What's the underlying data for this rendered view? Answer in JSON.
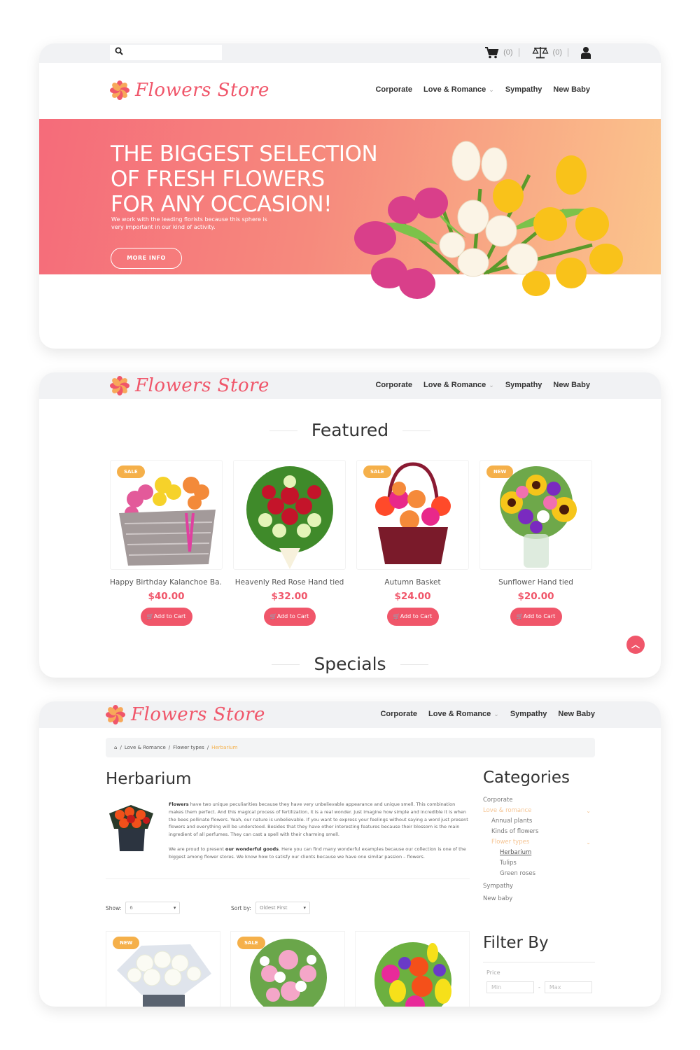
{
  "colors": {
    "accent": "#f0566a",
    "badge": "#f5b04a",
    "active_category": "#f5c493"
  },
  "topbar": {
    "search_placeholder": "",
    "cart_count": "(0)",
    "compare_count": "(0)"
  },
  "brand": {
    "name": "Flowers Store"
  },
  "nav": {
    "items": [
      {
        "label": "Corporate"
      },
      {
        "label": "Love & Romance",
        "has_dropdown": true
      },
      {
        "label": "Sympathy"
      },
      {
        "label": "New Baby"
      }
    ]
  },
  "hero": {
    "headline_1": "THE BIGGEST SELECTION",
    "headline_2": "OF FRESH FLOWERS",
    "headline_3": "FOR ANY OCCASION!",
    "text": "We work with the leading florists because this sphere is very important in our kind of activity.",
    "button": "MORE INFO"
  },
  "featured": {
    "title": "Featured",
    "products": [
      {
        "badge": "SALE",
        "name": "Happy Birthday Kalanchoe Ba...",
        "price": "$40.00",
        "cta": "Add to Cart"
      },
      {
        "badge": "",
        "name": "Heavenly Red Rose Hand tied",
        "price": "$32.00",
        "cta": "Add to Cart"
      },
      {
        "badge": "SALE",
        "name": "Autumn Basket",
        "price": "$24.00",
        "cta": "Add to Cart"
      },
      {
        "badge": "NEW",
        "name": "Sunflower Hand tied",
        "price": "$20.00",
        "cta": "Add to Cart"
      }
    ]
  },
  "specials": {
    "title": "Specials"
  },
  "category_page": {
    "breadcrumb": [
      "Love & Romance",
      "Flower types",
      "Herbarium"
    ],
    "title": "Herbarium",
    "desc_p1_bold": "Flowers",
    "desc_p1": " have two unique peculiarities because they have very unbelievable appearance and unique smell. This combination makes them perfect. And this magical process of fertilization, it is a real wonder. Just imagine how simple and incredible it is when the bees pollinate flowers. Yeah, our nature is unbelievable. If you want to express your feelings without saying a word just present flowers and everything will be understood. Besides that they have other interesting features because their blossom is the main ingredient of all perfumes. They can cast a spell with their charming smell.",
    "desc_p2_a": "We are proud to present ",
    "desc_p2_bold": "our wonderful goods",
    "desc_p2_b": ". Here you can find many wonderful examples because our collection is one of the biggest among flower stores. We know how to satisfy our clients because we have one similar passion – flowers.",
    "show_label": "Show:",
    "show_value": "6",
    "sort_label": "Sort by:",
    "sort_value": "Oldest First",
    "products": [
      {
        "badge": "NEW"
      },
      {
        "badge": "SALE"
      },
      {
        "badge": ""
      }
    ]
  },
  "sidebar": {
    "categories_title": "Categories",
    "categories": [
      {
        "label": "Corporate"
      },
      {
        "label": "Love & romance",
        "active": true,
        "expanded": true
      },
      {
        "label": "Annual plants"
      },
      {
        "label": "Kinds of flowers"
      },
      {
        "label": "Flower types",
        "active": true,
        "expanded": true
      },
      {
        "label": "Herbarium",
        "current": true
      },
      {
        "label": "Tulips"
      },
      {
        "label": "Green roses"
      },
      {
        "label": "Sympathy"
      },
      {
        "label": "New baby"
      }
    ],
    "filter_title": "Filter By",
    "price_label": "Price",
    "min_placeholder": "Min",
    "max_placeholder": "Max"
  }
}
